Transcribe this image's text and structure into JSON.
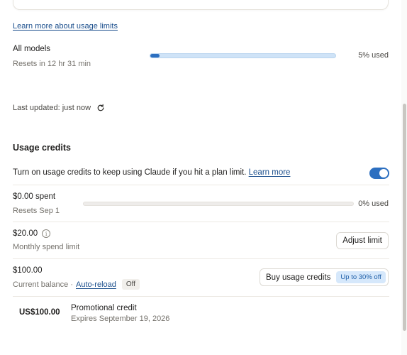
{
  "top_card": {
    "faded_text": "... ... ... ... ... ..."
  },
  "usage_limits": {
    "learn_more_link": "Learn more about usage limits",
    "all_models": {
      "label": "All models",
      "reset_text": "Resets in 12 hr 31 min",
      "percent_used_text": "5% used",
      "percent_used": 5
    },
    "last_updated_text": "Last updated: just now"
  },
  "usage_credits": {
    "title": "Usage credits",
    "toggle_text": "Turn on usage credits to keep using Claude if you hit a plan limit.",
    "toggle_learn_more": "Learn more",
    "toggle_on": true,
    "spent": {
      "label": "$0.00 spent",
      "reset_text": "Resets Sep 1",
      "percent_used_text": "0% used",
      "percent_used": 0
    },
    "limit": {
      "amount": "$20.00",
      "sub": "Monthly spend limit",
      "button": "Adjust limit"
    },
    "balance": {
      "amount": "$100.00",
      "sub_prefix": "Current balance ·",
      "auto_reload_link": "Auto-reload",
      "auto_reload_status": "Off",
      "buy_button": "Buy usage credits",
      "promo_badge": "Up to 30% off"
    },
    "promo_credit": {
      "amount": "US$100.00",
      "title": "Promotional credit",
      "expires": "Expires September 19, 2026"
    }
  },
  "colors": {
    "accent": "#2c6fc0",
    "link": "#1a4e8c",
    "bar_track": "#cfe3f7"
  }
}
